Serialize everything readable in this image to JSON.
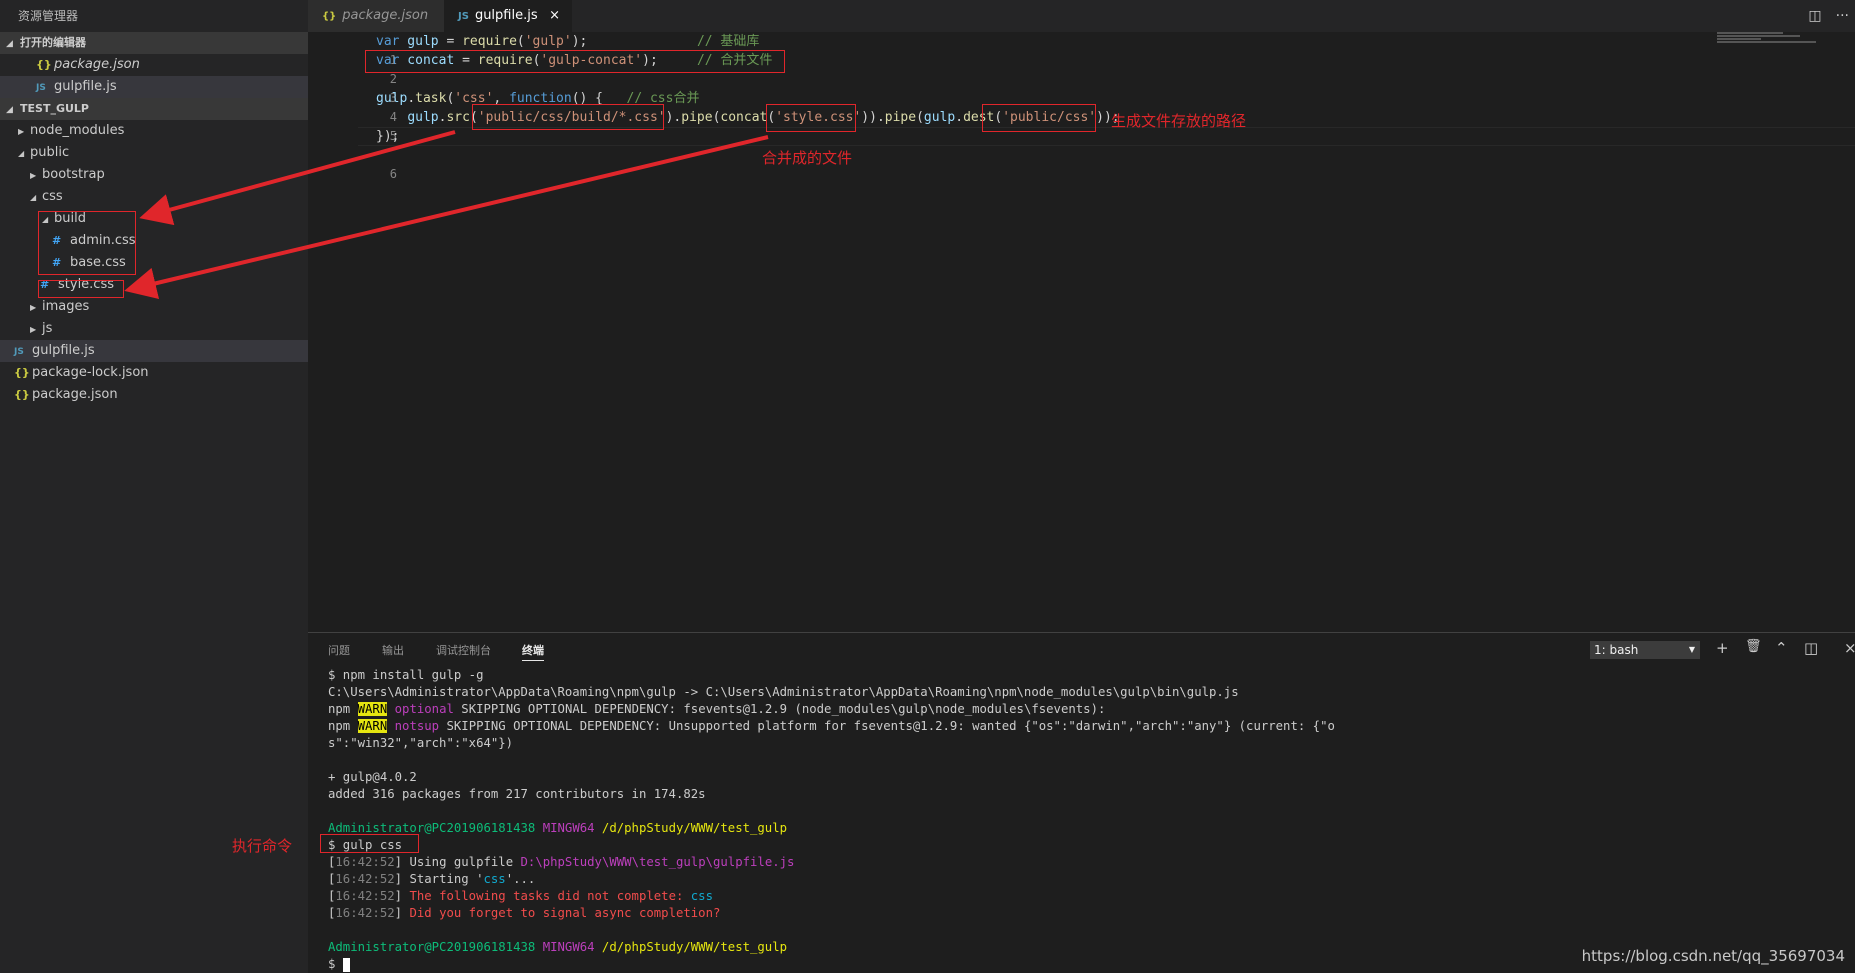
{
  "sidebar": {
    "title": "资源管理器",
    "open_editors_header": "打开的编辑器",
    "open_editors": [
      {
        "icon": "{}",
        "label": "package.json"
      },
      {
        "icon": "JS",
        "label": "gulpfile.js"
      }
    ],
    "project_header": "TEST_GULP",
    "tree": [
      {
        "label": "node_modules",
        "icon": ""
      },
      {
        "label": "public",
        "icon": ""
      },
      {
        "label": "bootstrap",
        "icon": ""
      },
      {
        "label": "css",
        "icon": ""
      },
      {
        "label": "build",
        "icon": ""
      },
      {
        "label": "admin.css",
        "icon": "#"
      },
      {
        "label": "base.css",
        "icon": "#"
      },
      {
        "label": "style.css",
        "icon": "#"
      },
      {
        "label": "images",
        "icon": ""
      },
      {
        "label": "js",
        "icon": ""
      },
      {
        "label": "gulpfile.js",
        "icon": "JS"
      },
      {
        "label": "package-lock.json",
        "icon": "{}"
      },
      {
        "label": "package.json",
        "icon": "{}"
      }
    ]
  },
  "tabs": [
    {
      "icon": "{}",
      "label": "package.json"
    },
    {
      "icon": "JS",
      "label": "gulpfile.js",
      "close": "×"
    }
  ],
  "editor_actions": {
    "split": "◫",
    "more": "···"
  },
  "code": {
    "line_numbers": [
      "1",
      "2",
      "3",
      "4",
      "5",
      "6"
    ],
    "l1": {
      "kw": "var",
      "v": " gulp",
      "eq": " = ",
      "fn": "require",
      "p1": "(",
      "s": "'gulp'",
      "p2": ");",
      "sp": "              ",
      "cm": "// 基础库"
    },
    "l2": {
      "kw": "var",
      "v": " concat",
      "eq": " = ",
      "fn": "require",
      "p1": "(",
      "s": "'gulp-concat'",
      "p2": ");",
      "sp": "     ",
      "cm": "// 合并文件"
    },
    "l4": {
      "v": "gulp",
      "dot": ".",
      "fn": "task",
      "p1": "(",
      "s": "'css'",
      "c": ", ",
      "kw": "function",
      "p2": "() {",
      "sp": "   ",
      "cm": "// css合并"
    },
    "l5": {
      "ind": "    ",
      "v": "gulp",
      "dot": ".",
      "fn": "src",
      "p1": "(",
      "s1": "'public/css/build/*.css'",
      "p2": ").",
      "fn2": "pipe",
      "p3": "(",
      "fn3": "concat",
      "p4": "(",
      "s2": "'style.css'",
      "p5": ")).",
      "fn4": "pipe",
      "p6": "(",
      "v2": "gulp",
      "dot2": ".",
      "fn5": "dest",
      "p7": "(",
      "s3": "'public/css'",
      "p8": "));"
    },
    "l6": "});"
  },
  "panel": {
    "tabs": [
      "问题",
      "输出",
      "调试控制台",
      "终端"
    ],
    "terminal_select": "1: bash",
    "actions": {
      "add": "+",
      "trash": "🗑",
      "up": "⌃",
      "split": "◫",
      "close": "×"
    }
  },
  "terminal": {
    "l1": "$ npm install gulp -g",
    "l2": "C:\\Users\\Administrator\\AppData\\Roaming\\npm\\gulp -> C:\\Users\\Administrator\\AppData\\Roaming\\npm\\node_modules\\gulp\\bin\\gulp.js",
    "l3": {
      "npm": "npm ",
      "warn": "WARN",
      "tag": " optional",
      "rest": " SKIPPING OPTIONAL DEPENDENCY: fsevents@1.2.9 (node_modules\\gulp\\node_modules\\fsevents):"
    },
    "l4": {
      "npm": "npm ",
      "warn": "WARN",
      "tag": " notsup",
      "rest": " SKIPPING OPTIONAL DEPENDENCY: Unsupported platform for fsevents@1.2.9: wanted {\"os\":\"darwin\",\"arch\":\"any\"} (current: {\"o"
    },
    "l5": "s\":\"win32\",\"arch\":\"x64\"})",
    "l7": "+ gulp@4.0.2",
    "l8": "added 316 packages from 217 contributors in 174.82s",
    "prompt1": {
      "user": "Administrator@PC201906181438",
      "env": " MINGW64",
      "path": " /d/phpStudy/WWW/test_gulp"
    },
    "l11": "$ gulp css",
    "l12": {
      "b1": "[",
      "time": "16:42:52",
      "b2": "]",
      "text": " Using gulpfile ",
      "file": "D:\\phpStudy\\WWW\\test_gulp\\gulpfile.js"
    },
    "l13": {
      "b1": "[",
      "time": "16:42:52",
      "b2": "]",
      "t1": " Starting '",
      "task": "css",
      "t2": "'..."
    },
    "l14": {
      "b1": "[",
      "time": "16:42:52",
      "b2": "]",
      "text": " The following tasks did not complete: ",
      "task": "css"
    },
    "l15": {
      "b1": "[",
      "time": "16:42:52",
      "b2": "]",
      "text": " Did you forget to signal async completion?"
    },
    "prompt2": {
      "user": "Administrator@PC201906181438",
      "env": " MINGW64",
      "path": " /d/phpStudy/WWW/test_gulp"
    },
    "l18": "$ "
  },
  "annotations": {
    "output_path": "生成文件存放的路径",
    "merged_file": "合并成的文件",
    "run_command": "执行命令",
    "color": "#e0262b"
  },
  "watermark": "https://blog.csdn.net/qq_35697034"
}
